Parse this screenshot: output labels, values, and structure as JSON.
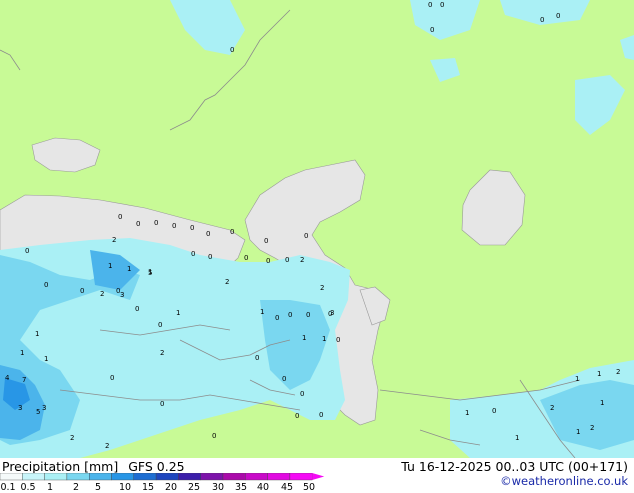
{
  "map": {
    "product": "Precipitation [mm]",
    "model": "GFS 0.25",
    "valid_time": "Tu 16-12-2025 00..03 UTC (00+171)",
    "credit": "©weatheronline.co.uk",
    "colors": {
      "land_dry": "#c8fa96",
      "sea": "#e6e6e6",
      "border": "#8c8c8c",
      "coast": "#999999",
      "precip_light": "#aaf0f5",
      "precip_mid": "#7ad7f0",
      "precip_heavy": "#4bb4eb",
      "precip_peak": "#2896e6"
    },
    "point_values": [
      "0",
      "0",
      "0",
      "0",
      "0",
      "0",
      "0",
      "0",
      "0",
      "0",
      "0",
      "0",
      "0",
      "0",
      "0",
      "0",
      "0",
      "0",
      "0",
      "0",
      "0",
      "0",
      "0",
      "0",
      "0",
      "0",
      "0",
      "0",
      "0",
      "0",
      "0",
      "0",
      "0",
      "0",
      "0",
      "0",
      "0",
      "0",
      "0",
      "0",
      "1",
      "1",
      "1",
      "1",
      "1",
      "1",
      "1",
      "1",
      "1",
      "1",
      "1",
      "1",
      "1",
      "1",
      "1",
      "1",
      "2",
      "2",
      "2",
      "2",
      "2",
      "2",
      "2",
      "2",
      "2",
      "2",
      "2",
      "3",
      "3",
      "3",
      "3",
      "5",
      "5",
      "4",
      "7"
    ],
    "legend": {
      "ticks": [
        "0.1",
        "0.5",
        "1",
        "2",
        "5",
        "10",
        "15",
        "20",
        "25",
        "30",
        "35",
        "40",
        "45",
        "50"
      ],
      "colors": [
        "#f5fafa",
        "#c8f5fa",
        "#aaf0f5",
        "#7ad7f0",
        "#4bb4eb",
        "#2896e6",
        "#1e6ed2",
        "#1e46be",
        "#3c1eaa",
        "#7d14aa",
        "#aa0aaa",
        "#c80ac8",
        "#e10ae1",
        "#f50af5"
      ]
    }
  }
}
